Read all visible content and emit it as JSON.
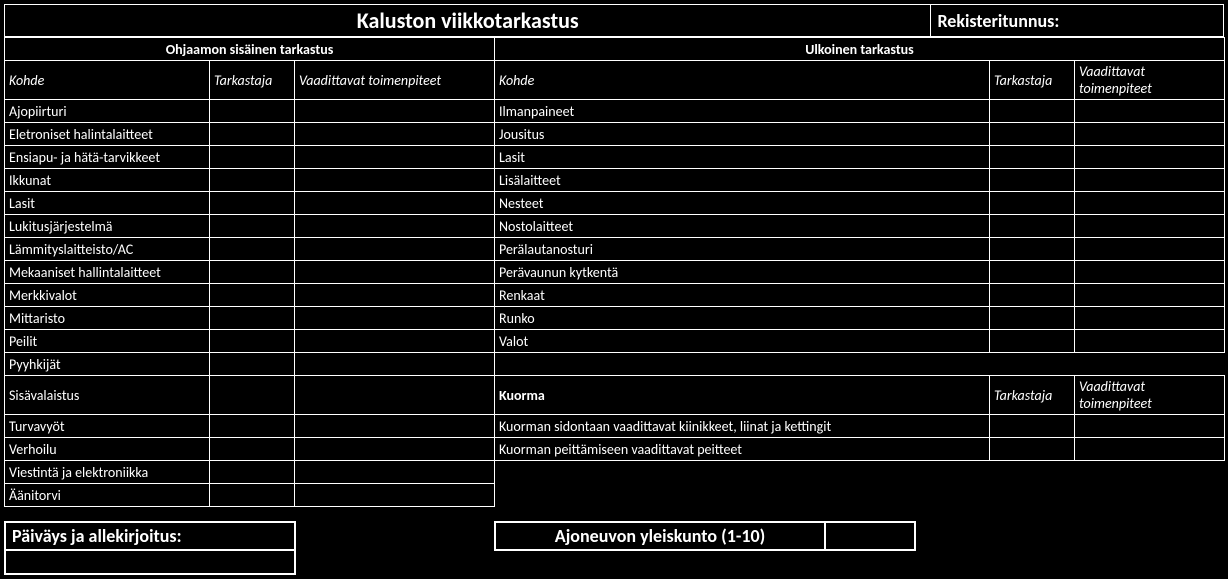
{
  "header": {
    "title": "Kaluston viikkotarkastus",
    "registration_label": "Rekisteritunnus:",
    "registration_value": ""
  },
  "sections": {
    "interior": {
      "title": "Ohjaamon sisäinen tarkastus",
      "cols": {
        "kohde": "Kohde",
        "tarkastaja": "Tarkastaja",
        "toimenpiteet": "Vaadittavat toimenpiteet"
      },
      "rows": [
        "Ajopiirturi",
        "Eletroniset halintalaitteet",
        "Ensiapu- ja hätä-tarvikkeet",
        "Ikkunat",
        "Lasit",
        "Lukitusjärjestelmä",
        "Lämmityslaitteisto/AC",
        "Mekaaniset hallintalaitteet",
        "Merkkivalot",
        "Mittaristo",
        "Peilit",
        "Pyyhkijät",
        "Sisävalaistus",
        "Turvavyöt",
        "Verhoilu",
        "Viestintä ja elektroniikka",
        "Äänitorvi"
      ]
    },
    "exterior": {
      "title": "Ulkoinen tarkastus",
      "cols": {
        "kohde": "Kohde",
        "tarkastaja": "Tarkastaja",
        "toimenpiteet": "Vaadittavat toimenpiteet"
      },
      "rows": [
        "Ilmanpaineet",
        "Jousitus",
        "Lasit",
        "Lisälaitteet",
        "Nesteet",
        "Nostolaitteet",
        "Perälautanosturi",
        "Perävaunun kytkentä",
        "Renkaat",
        "Runko",
        "Valot"
      ]
    },
    "cargo": {
      "title": "Kuorma",
      "cols": {
        "tarkastaja": "Tarkastaja",
        "toimenpiteet": "Vaadittavat toimenpiteet"
      },
      "rows": [
        "Kuorman sidontaan vaadittavat kiinikkeet, liinat ja kettingit",
        "Kuorman peittämiseen vaadittavat peitteet"
      ]
    }
  },
  "footer": {
    "date_sign_label": "Päiväys ja allekirjoitus:",
    "date_sign_value": "",
    "condition_label": "Ajoneuvon yleiskunto (1-10)",
    "condition_value": ""
  }
}
